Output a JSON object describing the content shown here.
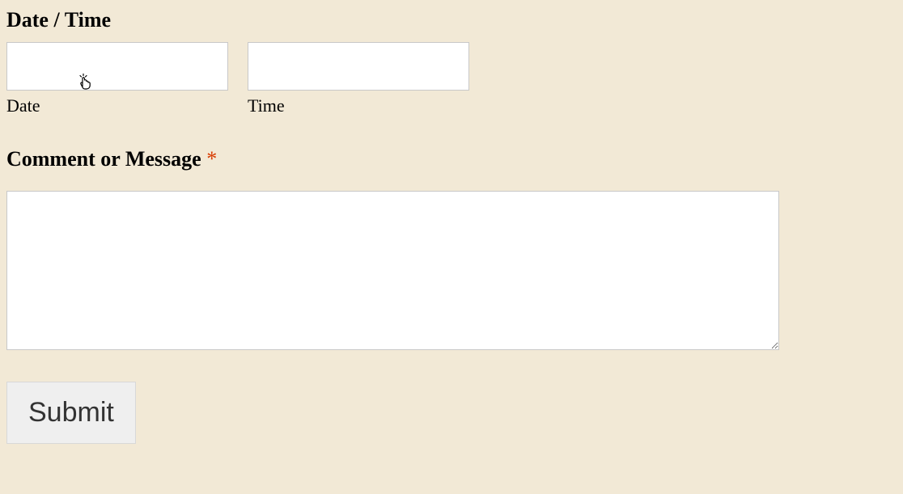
{
  "form": {
    "dateTime": {
      "heading": "Date / Time",
      "dateLabel": "Date",
      "timeLabel": "Time",
      "dateValue": "",
      "timeValue": ""
    },
    "comment": {
      "heading": "Comment or Message ",
      "requiredMark": "*",
      "value": ""
    },
    "submitLabel": "Submit"
  }
}
